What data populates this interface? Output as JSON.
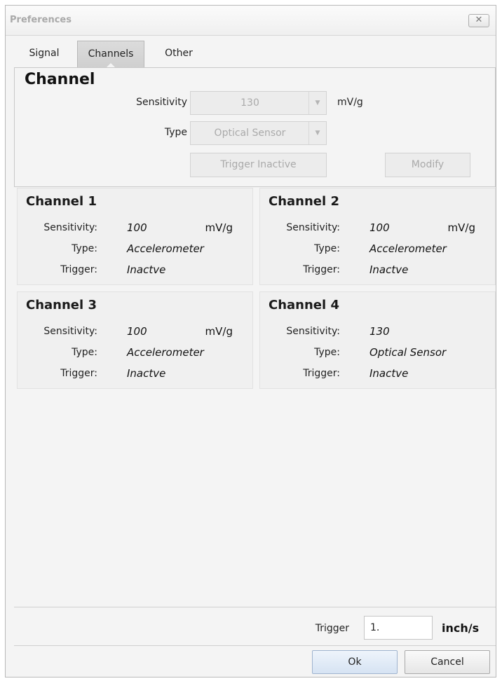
{
  "window": {
    "title": "Preferences",
    "close_glyph": "✕"
  },
  "tabs": [
    {
      "label": "Signal"
    },
    {
      "label": "Channels"
    },
    {
      "label": "Other"
    }
  ],
  "channel_editor": {
    "title": "Channel",
    "sensitivity_label": "Sensitivity",
    "sensitivity_value": "130",
    "sensitivity_unit": "mV/g",
    "type_label": "Type",
    "type_value": "Optical Sensor",
    "trigger_button": "Trigger Inactive",
    "modify_button": "Modify",
    "dropdown_icon": "chevron-down"
  },
  "channel_labels": {
    "sensitivity": "Sensitivity:",
    "type": "Type:",
    "trigger": "Trigger:"
  },
  "channels": [
    {
      "title": "Channel 1",
      "sensitivity": "100",
      "unit": "mV/g",
      "type": "Accelerometer",
      "trigger": "Inactve"
    },
    {
      "title": "Channel 2",
      "sensitivity": "100",
      "unit": "mV/g",
      "type": "Accelerometer",
      "trigger": "Inactve"
    },
    {
      "title": "Channel 3",
      "sensitivity": "100",
      "unit": "mV/g",
      "type": "Accelerometer",
      "trigger": "Inactve"
    },
    {
      "title": "Channel 4",
      "sensitivity": "130",
      "unit": "",
      "type": "Optical Sensor",
      "trigger": "Inactve"
    }
  ],
  "footer": {
    "trigger_label": "Trigger",
    "trigger_value": "1.",
    "trigger_unit": "inch/s",
    "ok_button": "Ok",
    "cancel_button": "Cancel"
  },
  "colors": {
    "dialog_bg": "#f4f4f4",
    "disabled_text": "#aaaaaa",
    "ok_button_bg": "#dde8f5",
    "active_tab_bg": "#d5d5d5"
  }
}
